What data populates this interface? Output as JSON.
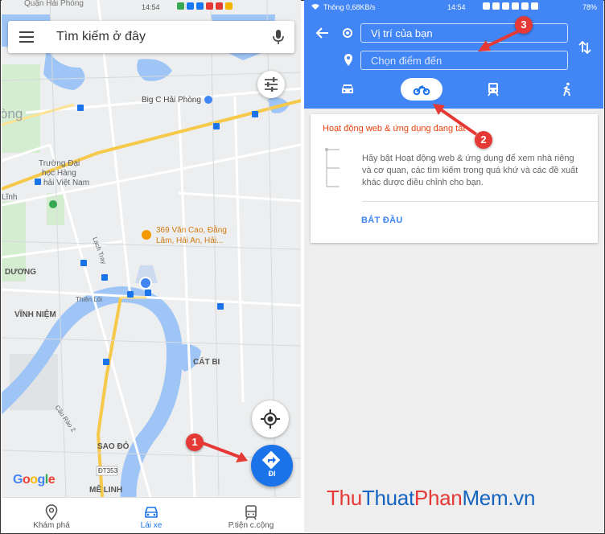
{
  "left_phone": {
    "status_bar": {
      "time": "14:54"
    },
    "search": {
      "placeholder": "Tìm kiếm ở đây"
    },
    "map_labels": {
      "hai_phong": "Quận Hải Phòng",
      "ong": "òng",
      "big_c": "Big C Hải Phòng",
      "truong": "Trường Đại",
      "hoc_hang": "học Hàng",
      "hai_viet_nam": "hải Việt Nam",
      "linh": "Lĩnh",
      "lach_tray": "Lạch Tray",
      "poi_369": "369 Văn Cao, Đằng",
      "poi_369_2": "Lâm, Hải An, Hải...",
      "duong": "DƯƠNG",
      "thien_loi": "Thiên Lôi",
      "vinh_niem": "VĨNH NIỆM",
      "cat_bi": "CÁT BI",
      "cau_rao": "Cầu Rào 2",
      "sao_do": "SAO ĐỎ",
      "dt353": "ĐT353",
      "me_linh": "MÊ LINH"
    },
    "google_logo": [
      "G",
      "o",
      "o",
      "g",
      "l",
      "e"
    ],
    "go_button": {
      "label": "ĐI"
    },
    "bottom_nav": [
      {
        "label": "Khám phá"
      },
      {
        "label": "Lái xe"
      },
      {
        "label": "P.tiện c.cộng"
      }
    ],
    "callout": "1"
  },
  "right_phone": {
    "status_bar": {
      "carrier": "Thông 0,68KB/s",
      "time": "14:54",
      "battery": "78%"
    },
    "from_field": {
      "value": "Vị trí của bạn"
    },
    "to_field": {
      "placeholder": "Chọn điểm đến"
    },
    "modes": [
      "car",
      "motorbike",
      "transit",
      "walk"
    ],
    "selected_mode": "motorbike",
    "card": {
      "title": "Hoạt động web & ứng dụng đang tắt",
      "body": "Hãy bật Hoạt động web & ứng dụng để xem nhà riêng và cơ quan, các tìm kiếm trong quá khứ và các đề xuất khác được điều chỉnh cho bạn.",
      "link": "BẮT ĐẦU"
    },
    "callouts": [
      "2",
      "3"
    ]
  },
  "watermark": {
    "p1": "Thu",
    "p2": "Thuat",
    "p3": "Phan",
    "p4": "Mem",
    "p5": ".vn"
  },
  "colors": {
    "accent": "#1a73e8",
    "header": "#4285f4",
    "callout": "#e53935",
    "warning_text": "#e8420c"
  }
}
